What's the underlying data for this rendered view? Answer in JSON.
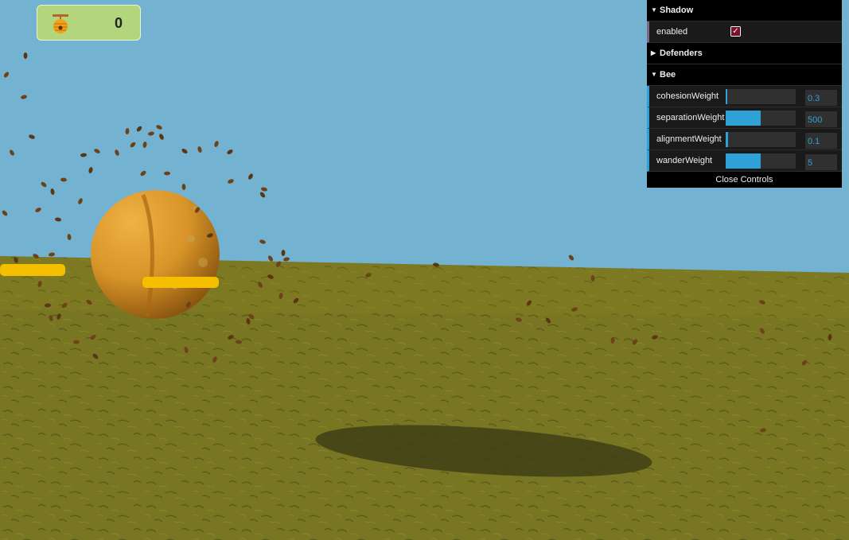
{
  "hud": {
    "score": "0",
    "icon": "beehive-icon"
  },
  "gui": {
    "folders": {
      "shadow": {
        "label": "Shadow",
        "enabled_label": "enabled",
        "enabled": true
      },
      "defenders": {
        "label": "Defenders"
      },
      "bee": {
        "label": "Bee",
        "params": [
          {
            "label": "cohesionWeight",
            "value": "0.3",
            "fraction": 0.02
          },
          {
            "label": "separationWeight",
            "value": "500",
            "fraction": 0.5
          },
          {
            "label": "alignmentWeight",
            "value": "0.1",
            "fraction": 0.03
          },
          {
            "label": "wanderWeight",
            "value": "5",
            "fraction": 0.5
          }
        ]
      }
    },
    "close_label": "Close Controls"
  },
  "colors": {
    "sky": "#73b2d0",
    "grass": "#7a7a22",
    "sphere": "#e19b2a",
    "bar": "#f5bf00",
    "slider": "#2fa1d6"
  }
}
